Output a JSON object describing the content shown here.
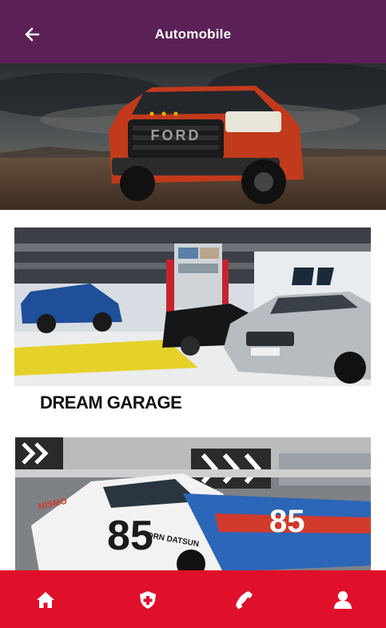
{
  "app": {
    "title": "Automobile"
  },
  "header": {
    "back_icon": "arrow-left-icon"
  },
  "hero": {
    "image": "red-pickup-truck-photo"
  },
  "cards": [
    {
      "label": "DREAM GARAGE",
      "image": "garage-workshop-photo"
    },
    {
      "label": "",
      "image": "race-car-85-photo"
    }
  ],
  "bottom_nav": {
    "items": [
      {
        "icon": "home-icon"
      },
      {
        "icon": "medical-shield-icon"
      },
      {
        "icon": "phone-icon"
      },
      {
        "icon": "user-icon"
      }
    ]
  },
  "colors": {
    "appbar": "#5b2157",
    "bottom_nav": "#e0102a"
  }
}
